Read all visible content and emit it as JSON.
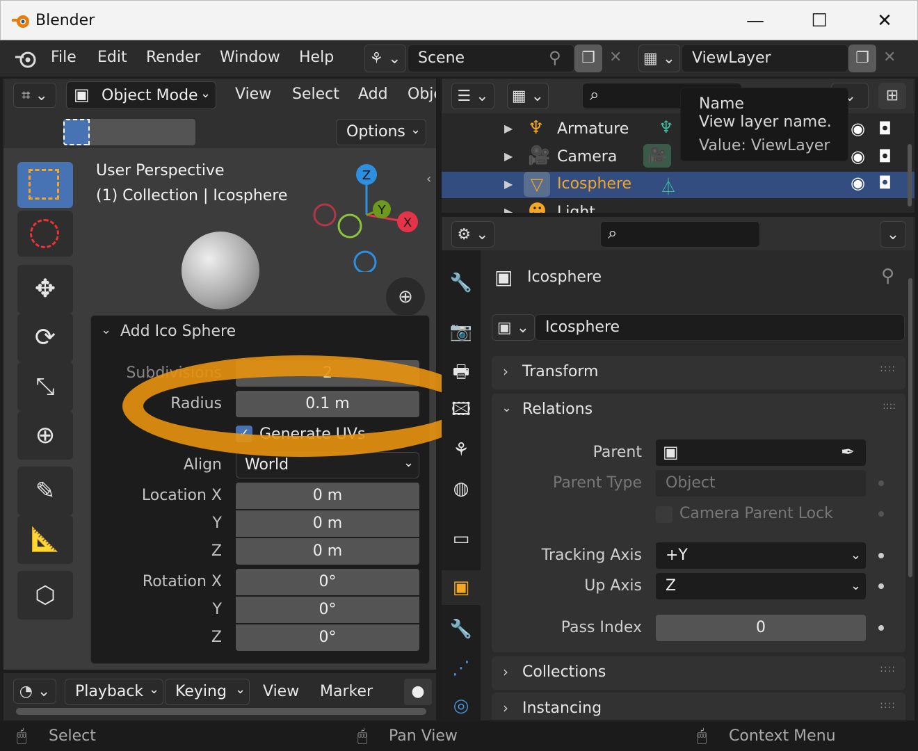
{
  "window": {
    "title": "Blender",
    "minimize": "—",
    "maximize": "☐",
    "close": "✕"
  },
  "menubar": {
    "items": [
      "File",
      "Edit",
      "Render",
      "Window",
      "Help"
    ],
    "scene_label": "Scene",
    "viewlayer_label": "ViewLayer"
  },
  "viewport": {
    "mode": "Object Mode",
    "menus": [
      "View",
      "Select",
      "Add",
      "Obje"
    ],
    "options": "Options",
    "overlay_line1": "User Perspective",
    "overlay_line2": "(1) Collection | Icosphere",
    "gizmo": {
      "z": "Z",
      "y": "Y",
      "x": "X"
    }
  },
  "operator_panel": {
    "title": "Add Ico Sphere",
    "subdivisions_label": "Subdivisions",
    "subdivisions_value": "2",
    "radius_label": "Radius",
    "radius_value": "0.1 m",
    "generate_uvs_label": "Generate UVs",
    "align_label": "Align",
    "align_value": "World",
    "location_label": "Location X",
    "location": {
      "x": "0 m",
      "y": "0 m",
      "z": "0 m"
    },
    "rotation_label": "Rotation X",
    "rotation": {
      "x": "0°",
      "y": "0°",
      "z": "0°"
    },
    "axis_y": "Y",
    "axis_z": "Z"
  },
  "timeline": {
    "menus": [
      "Playback",
      "Keying",
      "View",
      "Marker"
    ]
  },
  "outliner": {
    "rows": [
      {
        "name": "Armature",
        "icon": "armature-icon"
      },
      {
        "name": "Camera",
        "icon": "camera-icon"
      },
      {
        "name": "Icosphere",
        "icon": "mesh-icon"
      },
      {
        "name": "Light",
        "icon": "light-icon"
      }
    ],
    "tooltip": {
      "title": "Name",
      "desc": "View layer name.",
      "value": "Value: ViewLayer"
    }
  },
  "properties": {
    "object_name_header": "Icosphere",
    "object_name_field": "Icosphere",
    "sections": {
      "transform": "Transform",
      "relations": "Relations",
      "collections": "Collections",
      "instancing": "Instancing"
    },
    "relations": {
      "parent_label": "Parent",
      "parent_type_label": "Parent Type",
      "parent_type_value": "Object",
      "camera_parent_lock": "Camera Parent Lock",
      "tracking_axis_label": "Tracking Axis",
      "tracking_axis_value": "+Y",
      "up_axis_label": "Up Axis",
      "up_axis_value": "Z",
      "pass_index_label": "Pass Index",
      "pass_index_value": "0"
    }
  },
  "statusbar": {
    "left": "Select",
    "middle": "Pan View",
    "right": "Context Menu"
  },
  "colors": {
    "accent": "#4772b3",
    "highlight_ring": "#e8940f",
    "selected_text": "#f5a623"
  }
}
